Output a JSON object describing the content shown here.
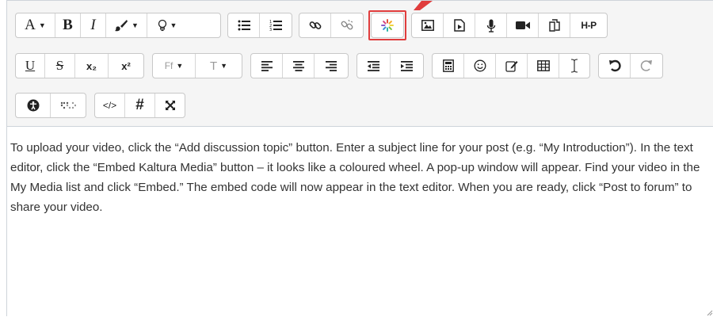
{
  "toolbar": {
    "row1": {
      "font_color_label": "A",
      "bold_label": "B",
      "italic_label": "I"
    },
    "row2": {
      "underline_label": "U",
      "strike_label": "S",
      "subscript_label": "x₂",
      "superscript_label": "x²",
      "font_family_label": "Ff",
      "font_size_label": "T"
    },
    "row3": {
      "html_label": "</>",
      "hash_label": "#"
    },
    "h5p_label": "H-P"
  },
  "icons": [
    "font-color-icon",
    "bold-icon",
    "italic-icon",
    "brush-icon",
    "lightbulb-icon",
    "unordered-list-icon",
    "ordered-list-icon",
    "link-icon",
    "unlink-icon",
    "kaltura-embed-icon",
    "image-icon",
    "media-file-icon",
    "microphone-icon",
    "video-icon",
    "manage-files-icon",
    "h5p-icon",
    "underline-icon",
    "strikethrough-icon",
    "subscript-icon",
    "superscript-icon",
    "font-family-icon",
    "font-size-icon",
    "align-left-icon",
    "align-center-icon",
    "align-right-icon",
    "outdent-icon",
    "indent-icon",
    "calculator-icon",
    "emoji-icon",
    "edit-icon",
    "table-icon",
    "cursor-icon",
    "undo-icon",
    "redo-icon",
    "accessibility-icon",
    "braille-icon",
    "html-icon",
    "hash-icon",
    "fullscreen-icon"
  ],
  "colors": {
    "highlight_border": "#e03d3d",
    "toolbar_bg": "#f5f5f5",
    "text": "#333333"
  },
  "content": {
    "text": "To upload your video, click the “Add discussion topic” button. Enter a subject line for your post (e.g. “My Introduction”). In the text editor, click the “Embed Kaltura Media” button – it looks like a coloured wheel. A pop-up window will appear. Find your video in the My Media list and click “Embed.” The embed code will now appear in the text editor. When you are ready, click “Post to forum” to share your video."
  }
}
